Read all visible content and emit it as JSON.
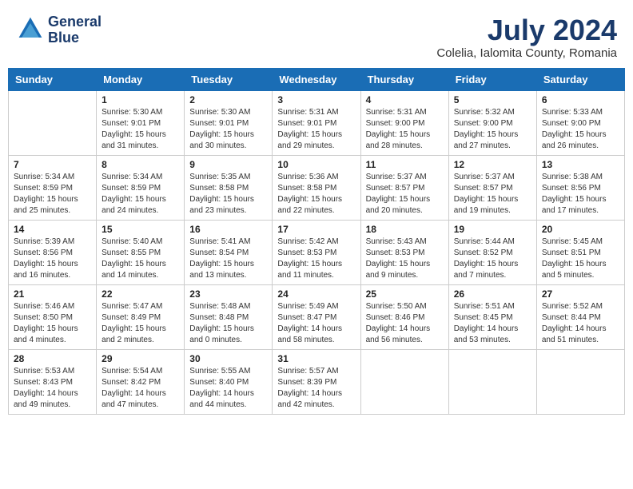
{
  "header": {
    "logo_line1": "General",
    "logo_line2": "Blue",
    "month": "July 2024",
    "location": "Colelia, Ialomita County, Romania"
  },
  "days_of_week": [
    "Sunday",
    "Monday",
    "Tuesday",
    "Wednesday",
    "Thursday",
    "Friday",
    "Saturday"
  ],
  "weeks": [
    [
      {
        "number": "",
        "sunrise": "",
        "sunset": "",
        "daylight": ""
      },
      {
        "number": "1",
        "sunrise": "Sunrise: 5:30 AM",
        "sunset": "Sunset: 9:01 PM",
        "daylight": "Daylight: 15 hours and 31 minutes."
      },
      {
        "number": "2",
        "sunrise": "Sunrise: 5:30 AM",
        "sunset": "Sunset: 9:01 PM",
        "daylight": "Daylight: 15 hours and 30 minutes."
      },
      {
        "number": "3",
        "sunrise": "Sunrise: 5:31 AM",
        "sunset": "Sunset: 9:01 PM",
        "daylight": "Daylight: 15 hours and 29 minutes."
      },
      {
        "number": "4",
        "sunrise": "Sunrise: 5:31 AM",
        "sunset": "Sunset: 9:00 PM",
        "daylight": "Daylight: 15 hours and 28 minutes."
      },
      {
        "number": "5",
        "sunrise": "Sunrise: 5:32 AM",
        "sunset": "Sunset: 9:00 PM",
        "daylight": "Daylight: 15 hours and 27 minutes."
      },
      {
        "number": "6",
        "sunrise": "Sunrise: 5:33 AM",
        "sunset": "Sunset: 9:00 PM",
        "daylight": "Daylight: 15 hours and 26 minutes."
      }
    ],
    [
      {
        "number": "7",
        "sunrise": "Sunrise: 5:34 AM",
        "sunset": "Sunset: 8:59 PM",
        "daylight": "Daylight: 15 hours and 25 minutes."
      },
      {
        "number": "8",
        "sunrise": "Sunrise: 5:34 AM",
        "sunset": "Sunset: 8:59 PM",
        "daylight": "Daylight: 15 hours and 24 minutes."
      },
      {
        "number": "9",
        "sunrise": "Sunrise: 5:35 AM",
        "sunset": "Sunset: 8:58 PM",
        "daylight": "Daylight: 15 hours and 23 minutes."
      },
      {
        "number": "10",
        "sunrise": "Sunrise: 5:36 AM",
        "sunset": "Sunset: 8:58 PM",
        "daylight": "Daylight: 15 hours and 22 minutes."
      },
      {
        "number": "11",
        "sunrise": "Sunrise: 5:37 AM",
        "sunset": "Sunset: 8:57 PM",
        "daylight": "Daylight: 15 hours and 20 minutes."
      },
      {
        "number": "12",
        "sunrise": "Sunrise: 5:37 AM",
        "sunset": "Sunset: 8:57 PM",
        "daylight": "Daylight: 15 hours and 19 minutes."
      },
      {
        "number": "13",
        "sunrise": "Sunrise: 5:38 AM",
        "sunset": "Sunset: 8:56 PM",
        "daylight": "Daylight: 15 hours and 17 minutes."
      }
    ],
    [
      {
        "number": "14",
        "sunrise": "Sunrise: 5:39 AM",
        "sunset": "Sunset: 8:56 PM",
        "daylight": "Daylight: 15 hours and 16 minutes."
      },
      {
        "number": "15",
        "sunrise": "Sunrise: 5:40 AM",
        "sunset": "Sunset: 8:55 PM",
        "daylight": "Daylight: 15 hours and 14 minutes."
      },
      {
        "number": "16",
        "sunrise": "Sunrise: 5:41 AM",
        "sunset": "Sunset: 8:54 PM",
        "daylight": "Daylight: 15 hours and 13 minutes."
      },
      {
        "number": "17",
        "sunrise": "Sunrise: 5:42 AM",
        "sunset": "Sunset: 8:53 PM",
        "daylight": "Daylight: 15 hours and 11 minutes."
      },
      {
        "number": "18",
        "sunrise": "Sunrise: 5:43 AM",
        "sunset": "Sunset: 8:53 PM",
        "daylight": "Daylight: 15 hours and 9 minutes."
      },
      {
        "number": "19",
        "sunrise": "Sunrise: 5:44 AM",
        "sunset": "Sunset: 8:52 PM",
        "daylight": "Daylight: 15 hours and 7 minutes."
      },
      {
        "number": "20",
        "sunrise": "Sunrise: 5:45 AM",
        "sunset": "Sunset: 8:51 PM",
        "daylight": "Daylight: 15 hours and 5 minutes."
      }
    ],
    [
      {
        "number": "21",
        "sunrise": "Sunrise: 5:46 AM",
        "sunset": "Sunset: 8:50 PM",
        "daylight": "Daylight: 15 hours and 4 minutes."
      },
      {
        "number": "22",
        "sunrise": "Sunrise: 5:47 AM",
        "sunset": "Sunset: 8:49 PM",
        "daylight": "Daylight: 15 hours and 2 minutes."
      },
      {
        "number": "23",
        "sunrise": "Sunrise: 5:48 AM",
        "sunset": "Sunset: 8:48 PM",
        "daylight": "Daylight: 15 hours and 0 minutes."
      },
      {
        "number": "24",
        "sunrise": "Sunrise: 5:49 AM",
        "sunset": "Sunset: 8:47 PM",
        "daylight": "Daylight: 14 hours and 58 minutes."
      },
      {
        "number": "25",
        "sunrise": "Sunrise: 5:50 AM",
        "sunset": "Sunset: 8:46 PM",
        "daylight": "Daylight: 14 hours and 56 minutes."
      },
      {
        "number": "26",
        "sunrise": "Sunrise: 5:51 AM",
        "sunset": "Sunset: 8:45 PM",
        "daylight": "Daylight: 14 hours and 53 minutes."
      },
      {
        "number": "27",
        "sunrise": "Sunrise: 5:52 AM",
        "sunset": "Sunset: 8:44 PM",
        "daylight": "Daylight: 14 hours and 51 minutes."
      }
    ],
    [
      {
        "number": "28",
        "sunrise": "Sunrise: 5:53 AM",
        "sunset": "Sunset: 8:43 PM",
        "daylight": "Daylight: 14 hours and 49 minutes."
      },
      {
        "number": "29",
        "sunrise": "Sunrise: 5:54 AM",
        "sunset": "Sunset: 8:42 PM",
        "daylight": "Daylight: 14 hours and 47 minutes."
      },
      {
        "number": "30",
        "sunrise": "Sunrise: 5:55 AM",
        "sunset": "Sunset: 8:40 PM",
        "daylight": "Daylight: 14 hours and 44 minutes."
      },
      {
        "number": "31",
        "sunrise": "Sunrise: 5:57 AM",
        "sunset": "Sunset: 8:39 PM",
        "daylight": "Daylight: 14 hours and 42 minutes."
      },
      {
        "number": "",
        "sunrise": "",
        "sunset": "",
        "daylight": ""
      },
      {
        "number": "",
        "sunrise": "",
        "sunset": "",
        "daylight": ""
      },
      {
        "number": "",
        "sunrise": "",
        "sunset": "",
        "daylight": ""
      }
    ]
  ]
}
